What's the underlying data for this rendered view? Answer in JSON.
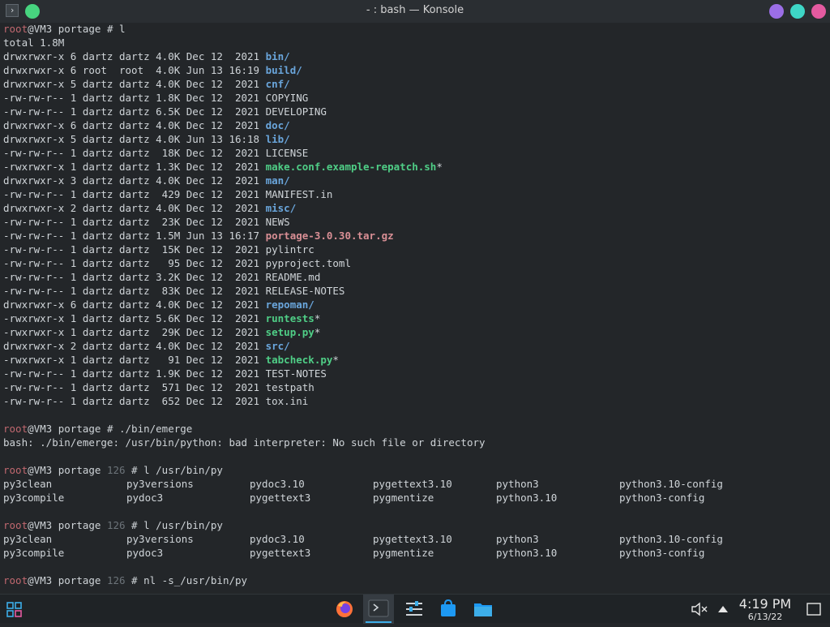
{
  "window": {
    "title": "- : bash — Konsole",
    "buttons": [
      "minimize",
      "maximize",
      "close"
    ],
    "colors": {
      "minimize": "#9b6ee6",
      "maximize": "#3ed6c6",
      "close": "#e45aa0",
      "pin": "#47d47f"
    }
  },
  "terminal": {
    "lines": [
      {
        "kind": "prompt",
        "user": "root",
        "host": "@VM3 portage",
        "status": "",
        "cmd": " # l"
      },
      {
        "kind": "text",
        "text": "total 1.8M"
      },
      {
        "kind": "file",
        "meta": "drwxrwxr-x 6 dartz dartz 4.0K Dec 12  2021 ",
        "name": "bin/",
        "cls": "dir"
      },
      {
        "kind": "file",
        "meta": "drwxrwxr-x 6 root  root  4.0K Jun 13 16:19 ",
        "name": "build/",
        "cls": "dir"
      },
      {
        "kind": "file",
        "meta": "drwxrwxr-x 5 dartz dartz 4.0K Dec 12  2021 ",
        "name": "cnf/",
        "cls": "dir"
      },
      {
        "kind": "file",
        "meta": "-rw-rw-r-- 1 dartz dartz 1.8K Dec 12  2021 ",
        "name": "COPYING",
        "cls": ""
      },
      {
        "kind": "file",
        "meta": "-rw-rw-r-- 1 dartz dartz 6.5K Dec 12  2021 ",
        "name": "DEVELOPING",
        "cls": ""
      },
      {
        "kind": "file",
        "meta": "drwxrwxr-x 6 dartz dartz 4.0K Dec 12  2021 ",
        "name": "doc/",
        "cls": "dir"
      },
      {
        "kind": "file",
        "meta": "drwxrwxr-x 5 dartz dartz 4.0K Jun 13 16:18 ",
        "name": "lib/",
        "cls": "dir"
      },
      {
        "kind": "file",
        "meta": "-rw-rw-r-- 1 dartz dartz  18K Dec 12  2021 ",
        "name": "LICENSE",
        "cls": ""
      },
      {
        "kind": "file",
        "meta": "-rwxrwxr-x 1 dartz dartz 1.3K Dec 12  2021 ",
        "name": "make.conf.example-repatch.sh",
        "cls": "exe",
        "suffix": "*"
      },
      {
        "kind": "file",
        "meta": "drwxrwxr-x 3 dartz dartz 4.0K Dec 12  2021 ",
        "name": "man/",
        "cls": "dir"
      },
      {
        "kind": "file",
        "meta": "-rw-rw-r-- 1 dartz dartz  429 Dec 12  2021 ",
        "name": "MANIFEST.in",
        "cls": ""
      },
      {
        "kind": "file",
        "meta": "drwxrwxr-x 2 dartz dartz 4.0K Dec 12  2021 ",
        "name": "misc/",
        "cls": "dir"
      },
      {
        "kind": "file",
        "meta": "-rw-rw-r-- 1 dartz dartz  23K Dec 12  2021 ",
        "name": "NEWS",
        "cls": ""
      },
      {
        "kind": "file",
        "meta": "-rw-rw-r-- 1 dartz dartz 1.5M Jun 13 16:17 ",
        "name": "portage-3.0.30.tar.gz",
        "cls": "arc"
      },
      {
        "kind": "file",
        "meta": "-rw-rw-r-- 1 dartz dartz  15K Dec 12  2021 ",
        "name": "pylintrc",
        "cls": ""
      },
      {
        "kind": "file",
        "meta": "-rw-rw-r-- 1 dartz dartz   95 Dec 12  2021 ",
        "name": "pyproject.toml",
        "cls": ""
      },
      {
        "kind": "file",
        "meta": "-rw-rw-r-- 1 dartz dartz 3.2K Dec 12  2021 ",
        "name": "README.md",
        "cls": ""
      },
      {
        "kind": "file",
        "meta": "-rw-rw-r-- 1 dartz dartz  83K Dec 12  2021 ",
        "name": "RELEASE-NOTES",
        "cls": ""
      },
      {
        "kind": "file",
        "meta": "drwxrwxr-x 6 dartz dartz 4.0K Dec 12  2021 ",
        "name": "repoman/",
        "cls": "dir"
      },
      {
        "kind": "file",
        "meta": "-rwxrwxr-x 1 dartz dartz 5.6K Dec 12  2021 ",
        "name": "runtests",
        "cls": "exe",
        "suffix": "*"
      },
      {
        "kind": "file",
        "meta": "-rwxrwxr-x 1 dartz dartz  29K Dec 12  2021 ",
        "name": "setup.py",
        "cls": "exe",
        "suffix": "*"
      },
      {
        "kind": "file",
        "meta": "drwxrwxr-x 2 dartz dartz 4.0K Dec 12  2021 ",
        "name": "src/",
        "cls": "dir"
      },
      {
        "kind": "file",
        "meta": "-rwxrwxr-x 1 dartz dartz   91 Dec 12  2021 ",
        "name": "tabcheck.py",
        "cls": "exe",
        "suffix": "*"
      },
      {
        "kind": "file",
        "meta": "-rw-rw-r-- 1 dartz dartz 1.9K Dec 12  2021 ",
        "name": "TEST-NOTES",
        "cls": ""
      },
      {
        "kind": "file",
        "meta": "-rw-rw-r-- 1 dartz dartz  571 Dec 12  2021 ",
        "name": "testpath",
        "cls": ""
      },
      {
        "kind": "file",
        "meta": "-rw-rw-r-- 1 dartz dartz  652 Dec 12  2021 ",
        "name": "tox.ini",
        "cls": ""
      },
      {
        "kind": "blank"
      },
      {
        "kind": "prompt",
        "user": "root",
        "host": "@VM3 portage",
        "status": "",
        "cmd": " # ./bin/emerge"
      },
      {
        "kind": "text",
        "text": "bash: ./bin/emerge: /usr/bin/python: bad interpreter: No such file or directory"
      },
      {
        "kind": "blank"
      },
      {
        "kind": "prompt",
        "user": "root",
        "host": "@VM3 portage",
        "status": " 126",
        "cmd": " # l /usr/bin/py"
      },
      {
        "kind": "cols",
        "items": [
          "py3clean",
          "py3versions",
          "pydoc3.10",
          "pygettext3.10",
          "python3",
          "python3.10-config"
        ]
      },
      {
        "kind": "cols",
        "items": [
          "py3compile",
          "pydoc3",
          "pygettext3",
          "pygmentize",
          "python3.10",
          "python3-config"
        ]
      },
      {
        "kind": "blank"
      },
      {
        "kind": "prompt",
        "user": "root",
        "host": "@VM3 portage",
        "status": " 126",
        "cmd": " # l /usr/bin/py"
      },
      {
        "kind": "cols",
        "items": [
          "py3clean",
          "py3versions",
          "pydoc3.10",
          "pygettext3.10",
          "python3",
          "python3.10-config"
        ]
      },
      {
        "kind": "cols",
        "items": [
          "py3compile",
          "pydoc3",
          "pygettext3",
          "pygmentize",
          "python3.10",
          "python3-config"
        ]
      },
      {
        "kind": "blank"
      },
      {
        "kind": "prompt",
        "user": "root",
        "host": "@VM3 portage",
        "status": " 126",
        "cmd": " # nl -s_/usr/bin/py"
      }
    ]
  },
  "taskbar": {
    "launcher": "application-launcher-icon",
    "apps": [
      "firefox-icon",
      "konsole-icon",
      "system-settings-icon",
      "discover-store-icon",
      "dolphin-files-icon"
    ],
    "active_app": "konsole-icon",
    "tray": [
      "volume-muted-icon",
      "tray-expand-icon"
    ],
    "time": "4:19 PM",
    "date": "6/13/22",
    "show_desktop": "show-desktop-icon"
  }
}
